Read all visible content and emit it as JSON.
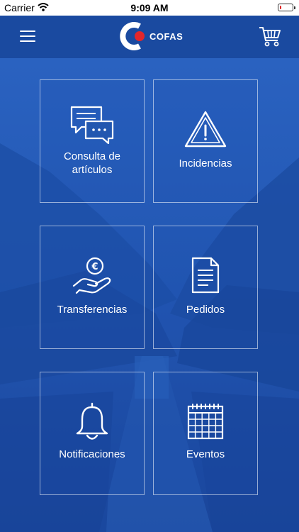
{
  "status_bar": {
    "carrier": "Carrier",
    "time": "9:09 AM",
    "battery_level": 0.15,
    "battery_color": "#e02020"
  },
  "nav": {
    "menu_icon": "hamburger-menu-icon",
    "brand": "COFAS",
    "logo_colors": {
      "ring": "#ffffff",
      "dot": "#e3262b"
    },
    "cart_icon": "shopping-cart-icon"
  },
  "background_color": "#1e4fa8",
  "tiles": [
    {
      "label_line1": "Consulta de",
      "label_line2": "artículos",
      "icon": "chat-bubbles-icon"
    },
    {
      "label_line1": "Incidencias",
      "icon": "warning-triangle-icon"
    },
    {
      "label_line1": "Transferencias",
      "icon": "euro-hand-icon"
    },
    {
      "label_line1": "Pedidos",
      "icon": "document-icon"
    },
    {
      "label_line1": "Notificaciones",
      "icon": "bell-icon"
    },
    {
      "label_line1": "Eventos",
      "icon": "calendar-icon"
    }
  ]
}
